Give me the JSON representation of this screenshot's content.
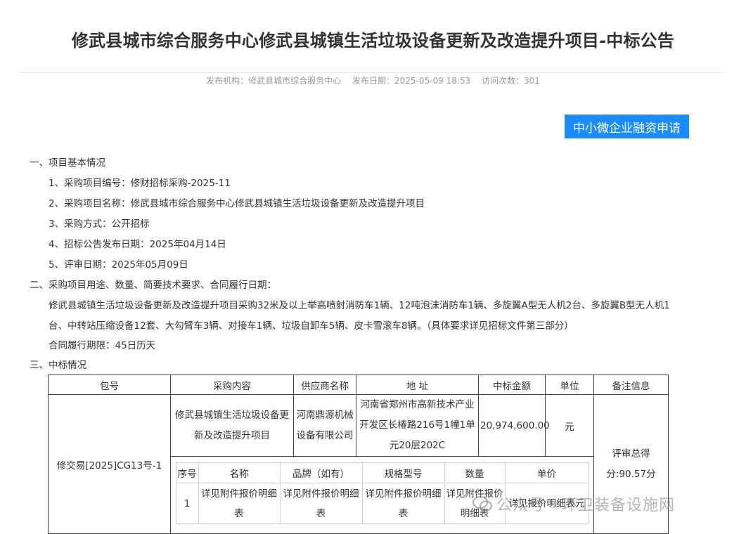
{
  "title": "修武县城市综合服务中心修武县城镇生活垃圾设备更新及改造提升项目-中标公告",
  "meta": {
    "publisher": "发布机构：修武县城市综合服务中心",
    "date": "发布日期：2025-05-09 18:53",
    "visits": "访问次数：301"
  },
  "finance_button": "中小微企业融资申请",
  "sections": {
    "s1": "一、项目基本情况",
    "s1_items": [
      "1、采购项目编号：修财招标采购-2025-11",
      "2、采购项目名称：修武县城市综合服务中心修武县城镇生活垃圾设备更新及改造提升项目",
      "3、采购方式：公开招标",
      "4、招标公告发布日期：2025年04月14日",
      "5、评审日期：2025年05月09日"
    ],
    "s2": "二、采购项目用途、数量、简要技术要求、合同履行日期：",
    "s2_line1": "修武县城镇生活垃圾设备更新及改造提升项目采购32米及以上举高喷射消防车1辆、12吨泡沫消防车1辆、多旋翼A型无人机2台、多旋翼B型无人机1",
    "s2_line2": "台、中转站压缩设备12套、大勾臂车3辆、对接车1辆、垃圾自卸车5辆、皮卡雪滚车8辆。（具体要求详见招标文件第三部分）",
    "s2_line3": "合同履行期限：45日历天",
    "s3": "三、中标情况"
  },
  "table": {
    "headers": [
      "包号",
      "采购内容",
      "供应商名称",
      "地 址",
      "中标金额",
      "单位",
      "备注信息"
    ],
    "row": {
      "package": "修交易[2025]CG13号-1",
      "content": "修武县城镇生活垃圾设备更新及改造提升项目",
      "supplier": "河南鼎源机械设备有限公司",
      "address": "河南省郑州市高新技术产业开发区长椿路216号1幢1单元20层202C",
      "amount": "20,974,600.00",
      "unit": "元",
      "remark": "评审总得分:90.57分"
    },
    "sub_headers": [
      "序号",
      "名称",
      "品牌（如有）",
      "规格型号",
      "数量",
      "单价"
    ],
    "sub_row": [
      "1",
      "详见附件报价明细表",
      "详见附件报价明细表",
      "详见附件报价明细表",
      "详见附件报价明细表",
      "详见报价明细表元"
    ]
  },
  "watermark": "公众号 · 环卫装备设施网"
}
